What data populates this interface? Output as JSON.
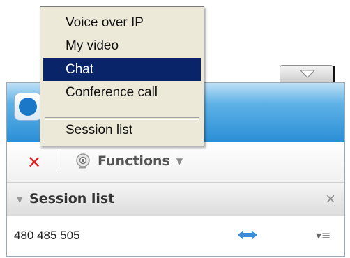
{
  "context_menu": {
    "items": [
      {
        "label": "Voice over IP"
      },
      {
        "label": "My video"
      },
      {
        "label": "Chat",
        "selected": true
      },
      {
        "label": "Conference call"
      },
      {
        "label": "Session list"
      }
    ]
  },
  "toolbar": {
    "close_icon": "close-x-icon",
    "functions_label": "Functions",
    "functions_icon": "webcam-icon"
  },
  "section": {
    "title": "Session list",
    "close_glyph": "×"
  },
  "session": {
    "id": "480 485 505",
    "connection_icon": "swap-arrows-icon",
    "menu_icon": "list-menu-icon"
  },
  "colors": {
    "menu_highlight": "#0a246a",
    "menu_background": "#ece9d8",
    "close_red": "#e02020",
    "header_blue": "#2b8fd6"
  }
}
